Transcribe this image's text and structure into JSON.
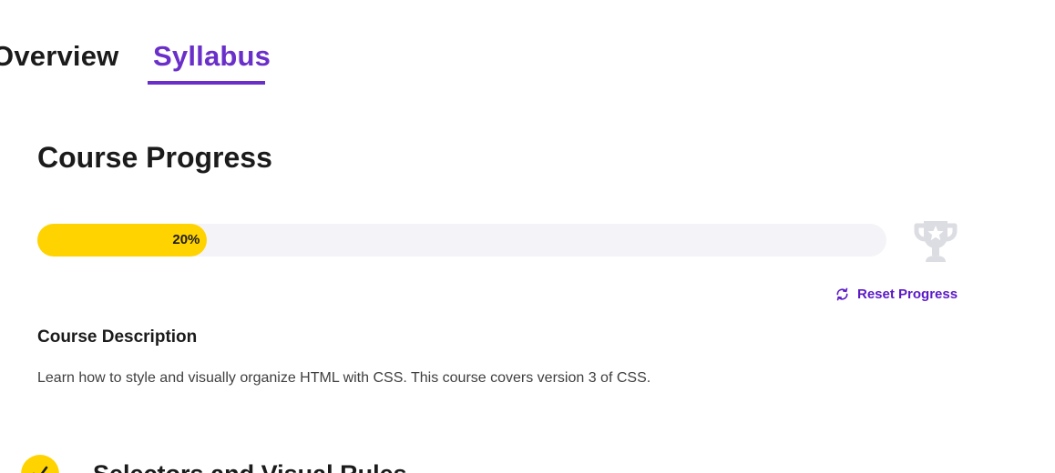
{
  "tabs": [
    {
      "label": "Overview",
      "active": false
    },
    {
      "label": "Syllabus",
      "active": true
    }
  ],
  "progress": {
    "title": "Course Progress",
    "percent": 20,
    "percent_label": "20%",
    "fill_color": "#ffd300",
    "track_color": "#f4f4f8",
    "trophy_icon": "trophy-icon"
  },
  "reset": {
    "label": "Reset Progress",
    "icon": "refresh-icon",
    "color": "#5b19c7"
  },
  "description": {
    "heading": "Course Description",
    "text": "Learn how to style and visually organize HTML with CSS. This course covers version 3 of CSS."
  },
  "modules": [
    {
      "title": "Selectors and Visual Rules",
      "completed": true,
      "icon": "checkmark-icon"
    }
  ],
  "colors": {
    "accent": "#6a2fc9",
    "progress": "#ffd300"
  }
}
